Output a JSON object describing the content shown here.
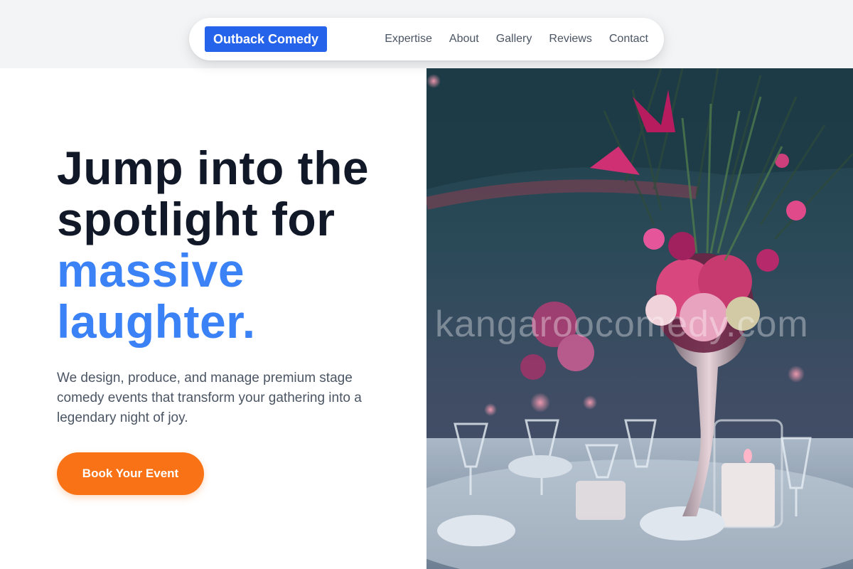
{
  "nav": {
    "brand": "Outback Comedy",
    "links": [
      "Expertise",
      "About",
      "Gallery",
      "Reviews",
      "Contact"
    ]
  },
  "hero": {
    "headline_part1": "Jump into the spotlight for ",
    "headline_accent": "massive laughter.",
    "subtext": "We design, produce, and manage premium stage comedy events that transform your gathering into a legendary night of joy.",
    "cta": "Book Your Event",
    "image_watermark": "kangaroocomedy.com"
  },
  "colors": {
    "brand_bg": "#2563eb",
    "accent": "#3b82f6",
    "cta": "#f97316",
    "heading": "#111827"
  }
}
